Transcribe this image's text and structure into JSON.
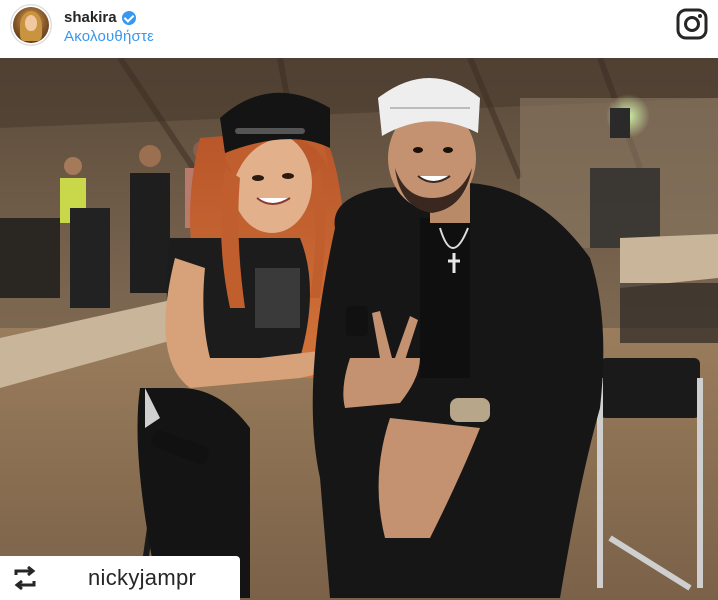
{
  "post": {
    "username": "shakira",
    "verified": true,
    "follow_label": "Ακολουθήστε",
    "repost_username": "nickyjampr"
  },
  "icons": {
    "avatar": "profile-avatar",
    "verified": "verified-badge-icon",
    "platform": "instagram-icon",
    "repost": "repost-icon"
  },
  "colors": {
    "link": "#3897f0",
    "verified": "#3897f0",
    "text": "#262626"
  }
}
